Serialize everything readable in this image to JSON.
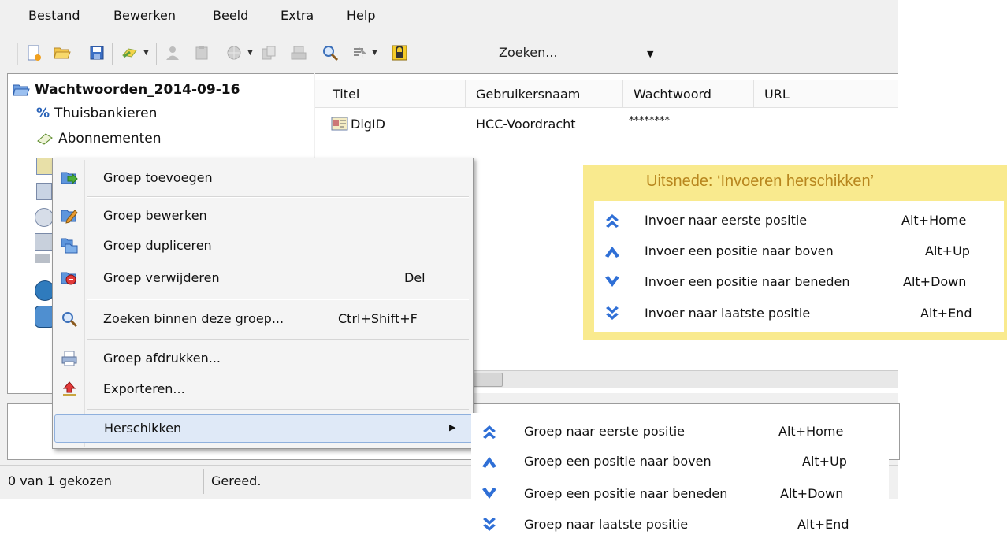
{
  "menubar": {
    "items": [
      "Bestand",
      "Bewerken",
      "Beeld",
      "Extra",
      "Help"
    ]
  },
  "toolbar": {
    "search_value": "Zoeken...",
    "icons": [
      "new-database-icon",
      "open-folder-icon",
      "save-icon",
      "add-entry-icon",
      "copy-username-icon",
      "copy-password-icon",
      "open-url-icon",
      "copy-url-icon",
      "perform-auto-type-icon",
      "find-icon",
      "quick-search-icon",
      "lock-icon"
    ]
  },
  "tree": {
    "root": "Wachtwoorden_2014-09-16",
    "items": [
      "Thuisbankieren",
      "Abonnementen"
    ]
  },
  "list": {
    "columns": [
      "Titel",
      "Gebruikersnaam",
      "Wachtwoord",
      "URL"
    ],
    "rows": [
      {
        "title": "DigID",
        "username": "HCC-Voordracht",
        "password": "********",
        "url": ""
      }
    ]
  },
  "statusbar": {
    "selection": "0 van 1 gekozen",
    "state": "Gereed."
  },
  "context_menu": {
    "items": [
      {
        "label": "Groep toevoegen",
        "key": ""
      },
      {
        "label": "Groep bewerken",
        "key": ""
      },
      {
        "label": "Groep dupliceren",
        "key": ""
      },
      {
        "label": "Groep verwijderen",
        "key": "Del"
      },
      {
        "label": "Zoeken binnen deze groep...",
        "key": "Ctrl+Shift+F"
      },
      {
        "label": "Groep afdrukken...",
        "key": ""
      },
      {
        "label": "Exporteren...",
        "key": ""
      },
      {
        "label": "Herschikken",
        "key": ""
      }
    ]
  },
  "submenu": {
    "items": [
      {
        "label": "Groep naar eerste positie",
        "key": "Alt+Home"
      },
      {
        "label": "Groep een positie naar boven",
        "key": "Alt+Up"
      },
      {
        "label": "Groep een positie naar beneden",
        "key": "Alt+Down"
      },
      {
        "label": "Groep naar laatste positie",
        "key": "Alt+End"
      }
    ]
  },
  "callout": {
    "title": "Uitsnede: ‘Invoeren herschikken’",
    "items": [
      {
        "label": "Invoer naar eerste positie",
        "key": "Alt+Home"
      },
      {
        "label": "Invoer een positie naar boven",
        "key": "Alt+Up"
      },
      {
        "label": "Invoer een positie naar beneden",
        "key": "Alt+Down"
      },
      {
        "label": "Invoer naar laatste positie",
        "key": "Alt+End"
      }
    ]
  },
  "colors": {
    "callout_bg": "#f9ea8e",
    "callout_title": "#b8861e",
    "arrow_icon": "#2f6fd6",
    "highlight": "#dfe9f7"
  }
}
